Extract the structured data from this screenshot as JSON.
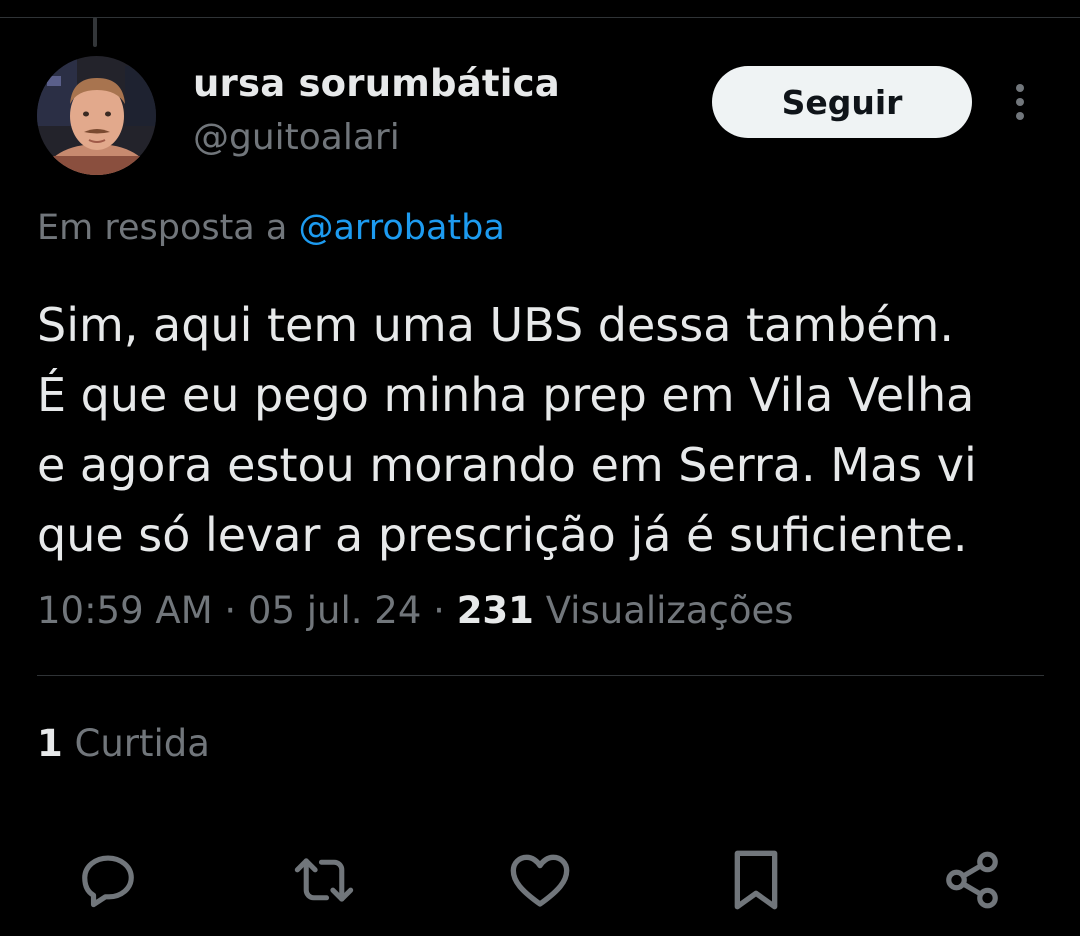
{
  "tweet": {
    "author": {
      "display_name": "ursa sorumbática",
      "handle": "@guitoalari"
    },
    "follow_label": "Seguir",
    "reply_context": {
      "prefix": "Em resposta a",
      "mention": "@arrobatba"
    },
    "text": "Sim, aqui tem uma UBS dessa também.\nÉ que eu pego minha prep em Vila Velha\ne agora estou morando em Serra. Mas vi\nque só levar a prescrição já é suficiente.",
    "meta": {
      "time": "10:59 AM",
      "separator": "·",
      "date": "05 jul. 24",
      "views_count": "231",
      "views_label": "Visualizações"
    },
    "likes": {
      "count": "1",
      "label": "Curtida"
    }
  },
  "actions": [
    {
      "icon": "reply-icon"
    },
    {
      "icon": "retweet-icon"
    },
    {
      "icon": "like-icon"
    },
    {
      "icon": "bookmark-icon"
    },
    {
      "icon": "share-icon"
    }
  ],
  "colors": {
    "background": "#000000",
    "text_primary": "#e7e9ea",
    "text_secondary": "#71767b",
    "accent": "#1d9bf0",
    "divider": "#2f3336",
    "follow_button_bg": "#eff3f4",
    "follow_button_text": "#0f1419"
  }
}
